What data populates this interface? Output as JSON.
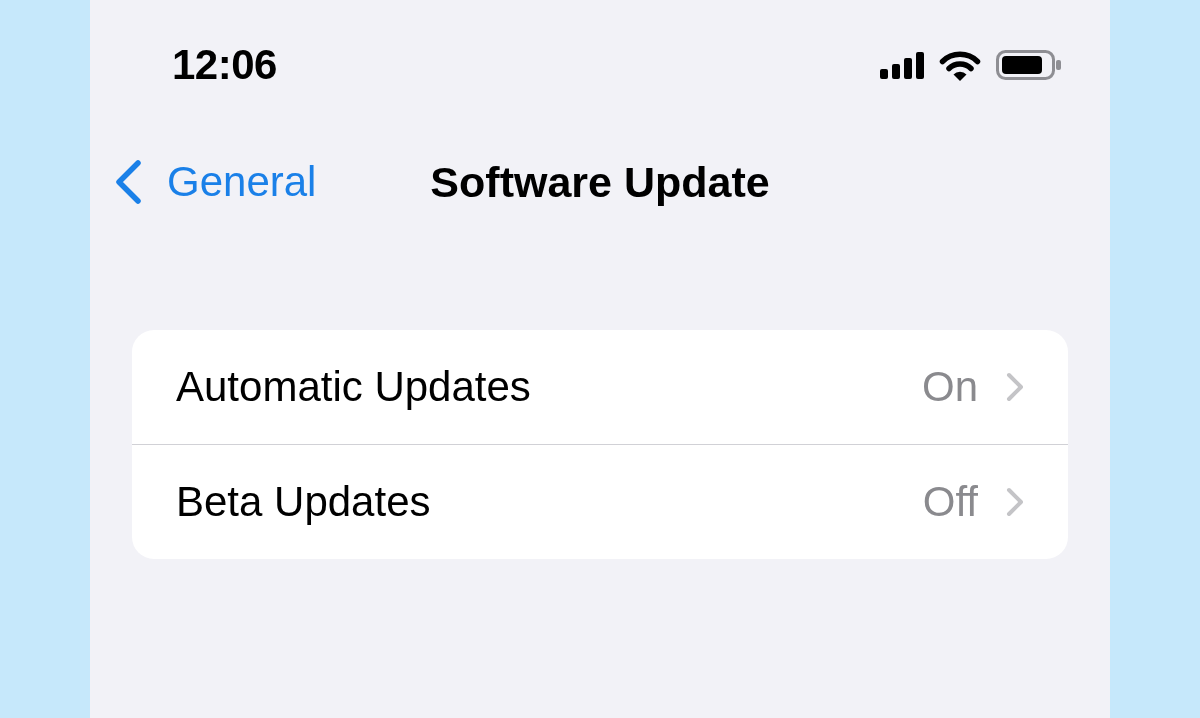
{
  "status_bar": {
    "time": "12:06"
  },
  "nav_bar": {
    "back": {
      "label": "General"
    },
    "title": "Software Update"
  },
  "settings": [
    {
      "label": "Automatic Updates",
      "value": "On"
    },
    {
      "label": "Beta Updates",
      "value": "Off"
    }
  ]
}
